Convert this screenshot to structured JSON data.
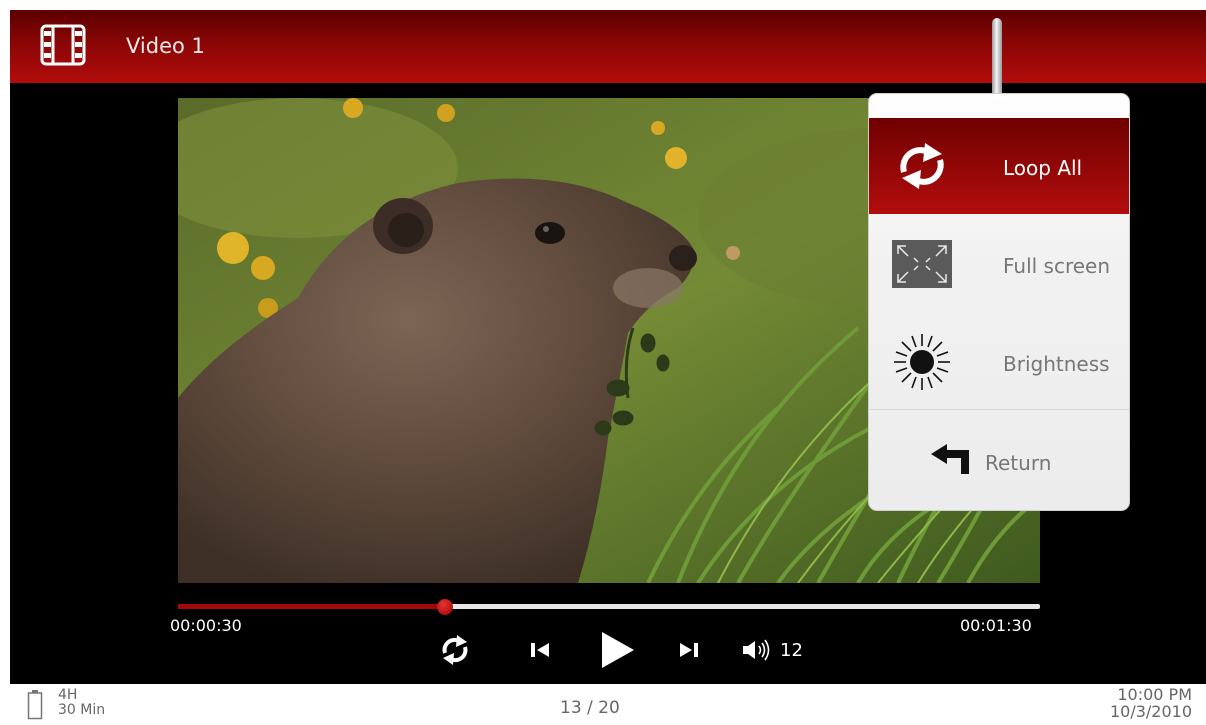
{
  "header": {
    "title": "Video 1",
    "icon": "film-icon"
  },
  "player": {
    "current_time": "00:00:30",
    "total_time": "00:01:30",
    "progress_fraction": 0.31,
    "volume": "12",
    "controls": [
      "loop-icon",
      "previous-icon",
      "play-icon",
      "next-icon",
      "volume-icon"
    ]
  },
  "menu": {
    "items": [
      {
        "label": "Loop  All",
        "icon": "loop-icon",
        "selected": true
      },
      {
        "label": "Full screen",
        "icon": "fullscreen-icon",
        "selected": false
      },
      {
        "label": "Brightness",
        "icon": "brightness-icon",
        "selected": false
      }
    ],
    "return_label": "Return"
  },
  "status": {
    "battery_hours": "4H",
    "battery_minutes": "30 Min",
    "page_counter": "13 / 20",
    "time": "10:00 PM",
    "date": "10/3/2010"
  },
  "colors": {
    "accent_red": "#a30808",
    "header_dark": "#5c0000",
    "menu_text": "#777777"
  }
}
